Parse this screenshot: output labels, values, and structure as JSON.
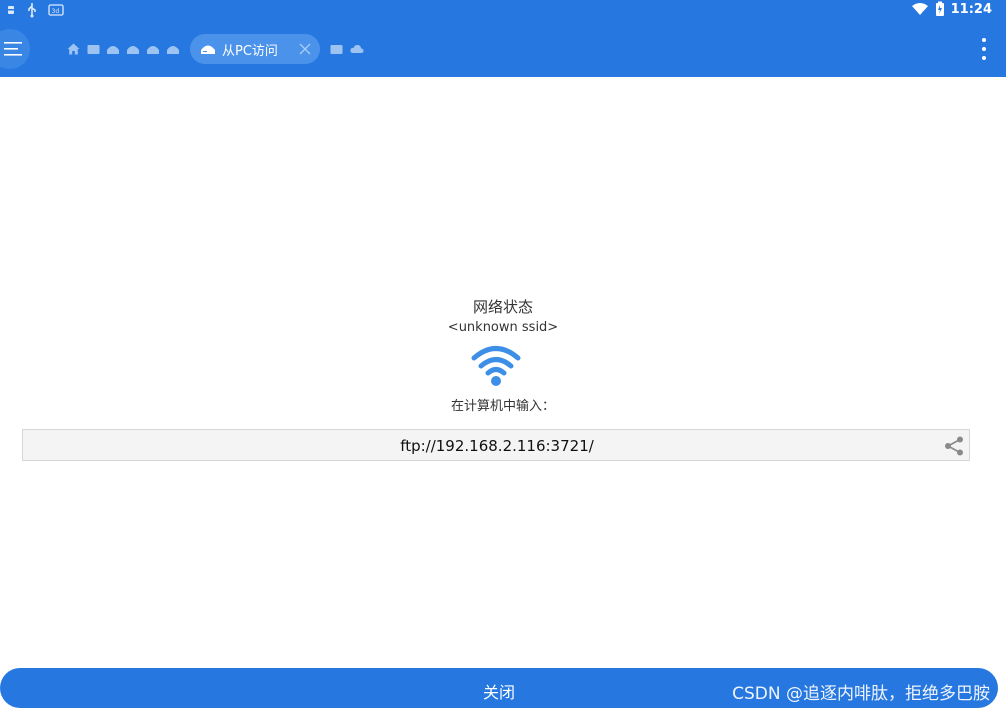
{
  "status_bar": {
    "time": "11:24",
    "icons": [
      "notification-icon",
      "usb-icon",
      "screenshot-icon",
      "wifi-signal-icon",
      "battery-icon"
    ]
  },
  "app_bar": {
    "breadcrumbs": [
      "home-icon",
      "folder-icon",
      "network-icon",
      "network-icon",
      "network-icon",
      "network-icon"
    ],
    "active_tab_label": "从PC访问",
    "trailing_icons": [
      "folder-icon",
      "cloud-icon"
    ]
  },
  "main": {
    "network_status_title": "网络状态",
    "ssid": "<unknown ssid>",
    "hint": "在计算机中输入：",
    "ftp_url": "ftp://192.168.2.116:3721/"
  },
  "footer": {
    "close_label": "关闭",
    "watermark": "CSDN @追逐内啡肽，拒绝多巴胺"
  },
  "colors": {
    "accent": "#2678e0",
    "wifi_icon": "#3d8ee6"
  }
}
